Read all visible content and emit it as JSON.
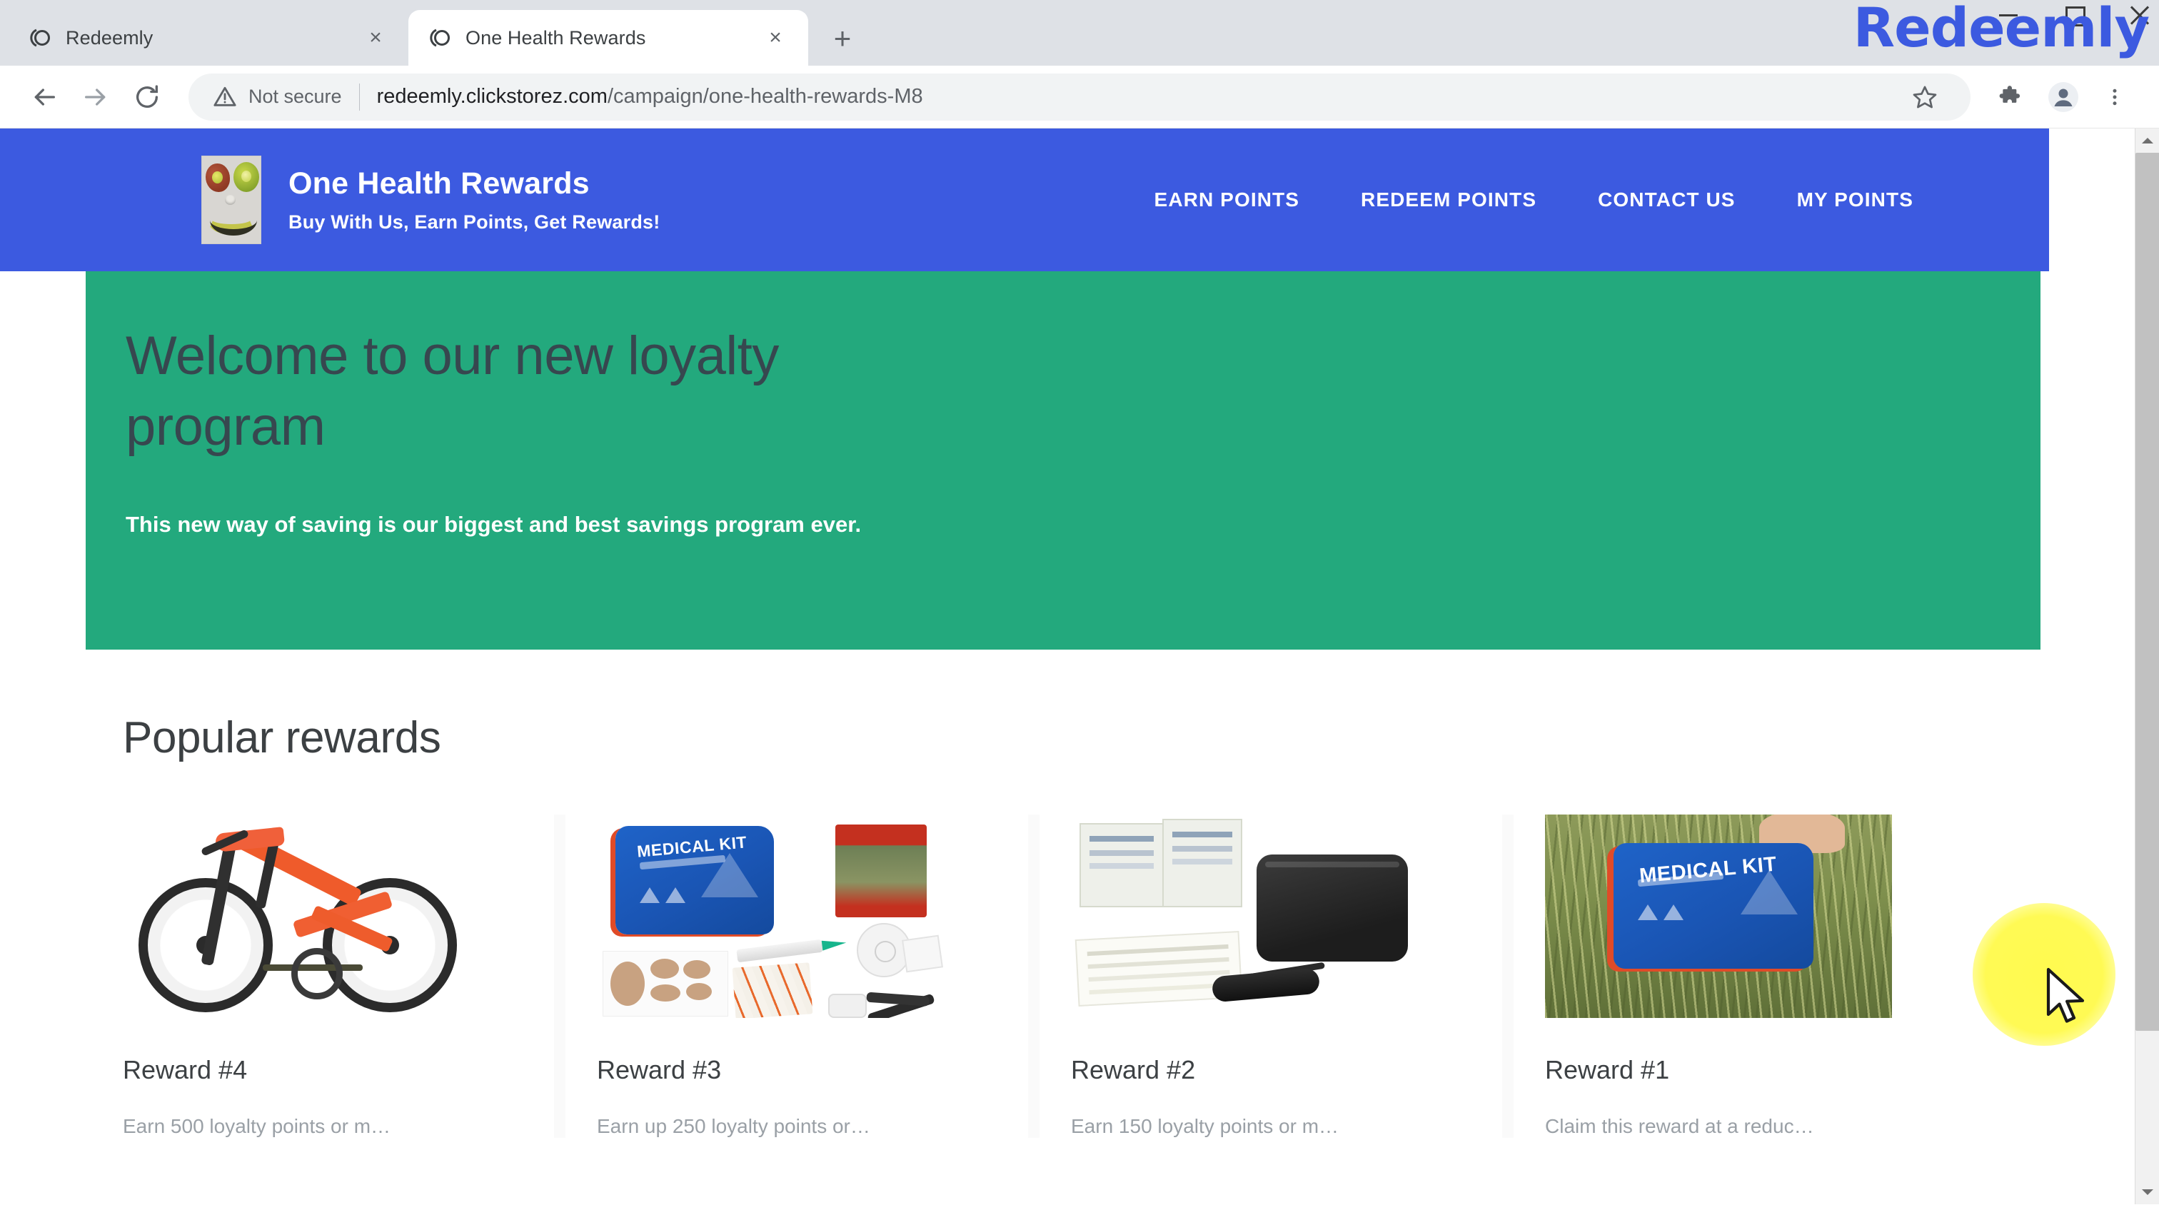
{
  "browser": {
    "tabs": [
      {
        "title": "Redeemly",
        "favicon": "redeemly-favicon",
        "active": false,
        "close_label": "×"
      },
      {
        "title": "One Health Rewards",
        "favicon": "redeemly-favicon",
        "active": true,
        "close_label": "×"
      }
    ],
    "new_tab_label": "+",
    "nav": {
      "back_label": "Back",
      "forward_label": "Forward",
      "reload_label": "Reload"
    },
    "omnibox": {
      "security_label": "Not secure",
      "url_host": "redeemly.clickstorez.com",
      "url_path": "/campaign/one-health-rewards-M8",
      "url_full": "redeemly.clickstorez.com/campaign/one-health-rewards-M8"
    },
    "toolbar_icons": [
      "star-icon",
      "extensions-puzzle-icon",
      "profile-avatar-icon",
      "more-menu-icon"
    ],
    "window_controls": [
      "minimize",
      "maximize",
      "close"
    ],
    "watermark": "Redeemly"
  },
  "site": {
    "header": {
      "brand_title": "One Health Rewards",
      "brand_tagline": "Buy With Us, Earn Points, Get Rewards!",
      "logo_alt": "fruit-face-logo",
      "nav": [
        {
          "label": "EARN POINTS",
          "name": "nav-earn-points"
        },
        {
          "label": "REDEEM POINTS",
          "name": "nav-redeem-points"
        },
        {
          "label": "CONTACT US",
          "name": "nav-contact-us"
        },
        {
          "label": "MY POINTS",
          "name": "nav-my-points"
        }
      ],
      "bg_color": "#3c5ae0"
    },
    "hero": {
      "title": "Welcome to our new loyalty program",
      "subtitle": "This new way of saving is our biggest and best savings program ever.",
      "bg_color": "#23a97d",
      "title_color": "#37474f"
    },
    "popular": {
      "section_title": "Popular rewards",
      "cards": [
        {
          "title": "Reward #4",
          "description": "Earn 500 loyalty points or m…",
          "image": "orange-bicycle-image",
          "image_type": "bike"
        },
        {
          "title": "Reward #3",
          "description": "Earn up 250 loyalty points or…",
          "image": "medical-kit-supplies-image",
          "image_type": "medkit"
        },
        {
          "title": "Reward #2",
          "description": "Earn 150 loyalty points or m…",
          "image": "blood-pressure-monitor-kit-image",
          "image_type": "bpkit"
        },
        {
          "title": "Reward #1",
          "description": "Claim this reward at a reduc…",
          "image": "medical-kit-in-field-image",
          "image_type": "medkit-field"
        }
      ]
    }
  },
  "cursor": {
    "highlight_color": "#fffa46"
  }
}
